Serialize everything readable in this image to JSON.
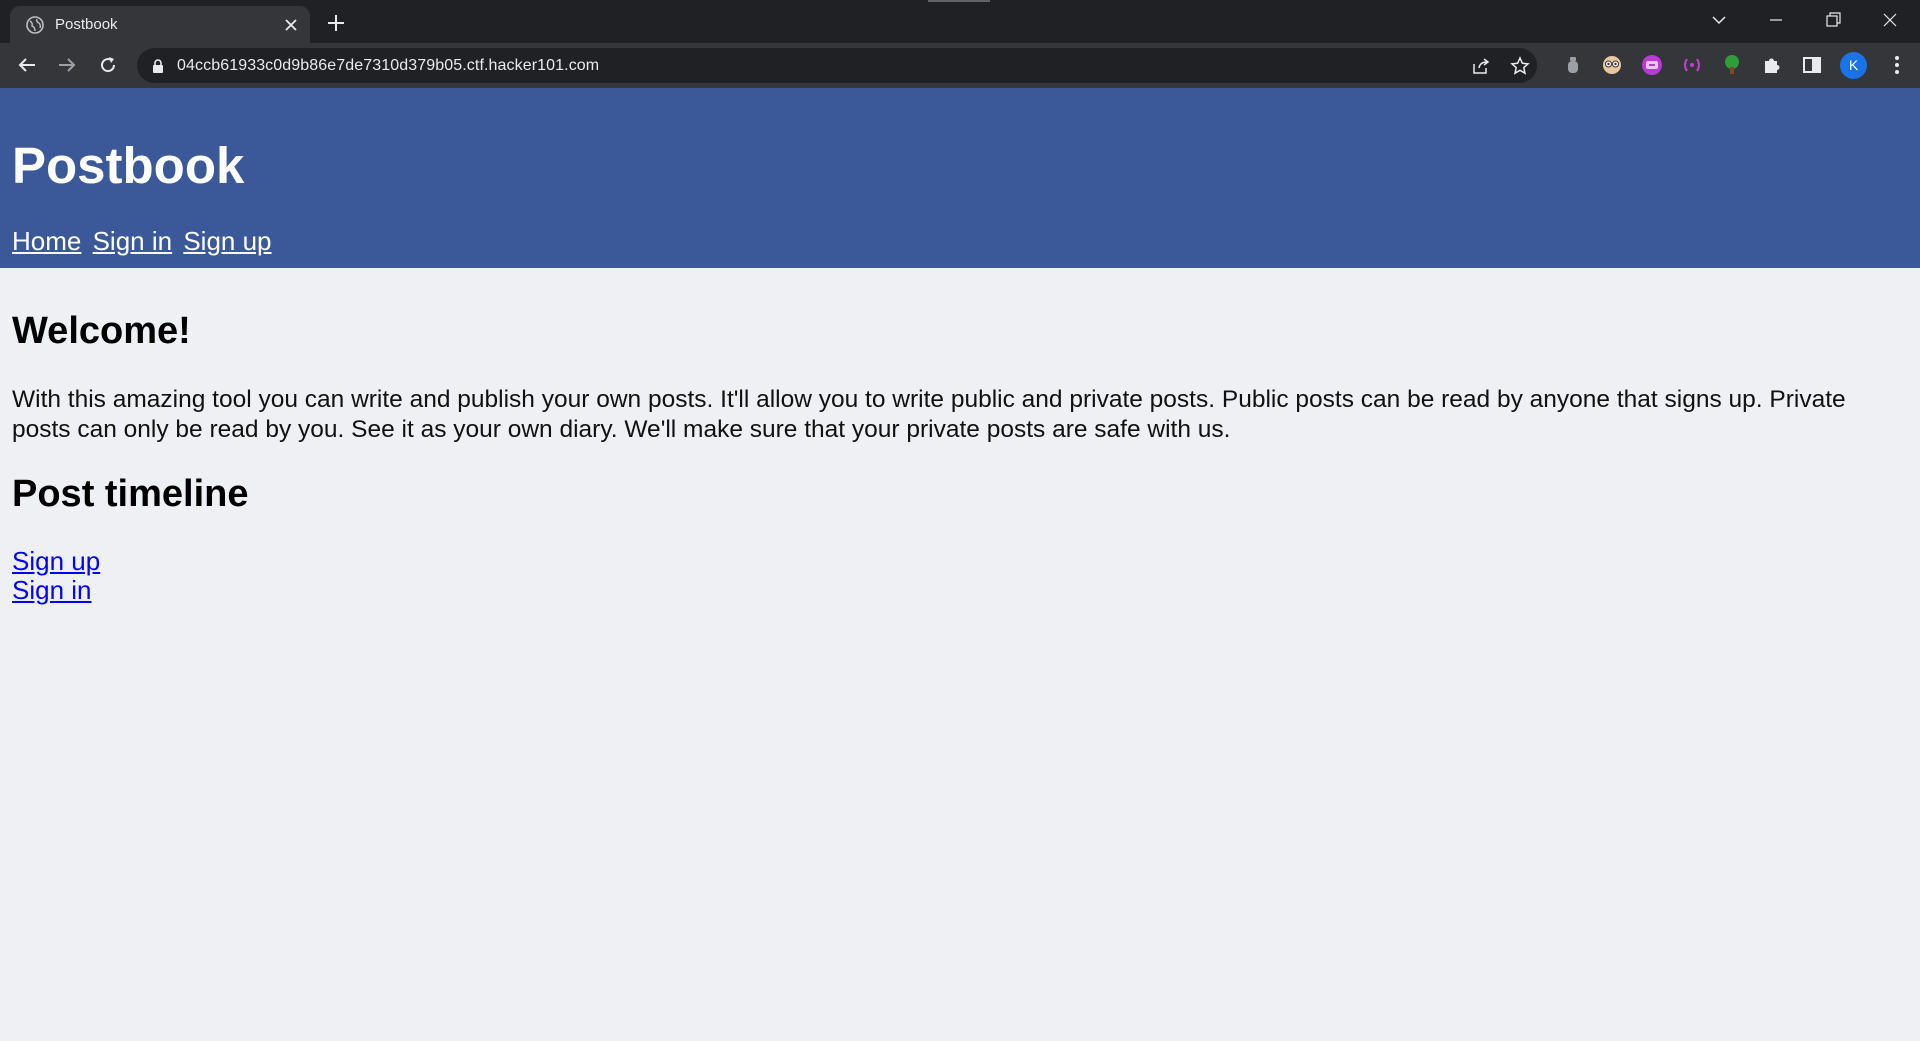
{
  "browser": {
    "tab_title": "Postbook",
    "url": "04ccb61933c0d9b86e7de7310d379b05.ctf.hacker101.com",
    "profile_initial": "K",
    "icons": [
      "globe-icon",
      "close-icon",
      "plus-icon",
      "back-icon",
      "forward-icon",
      "reload-icon",
      "lock-icon",
      "share-icon",
      "star-icon",
      "puzzle-icon",
      "sidepanel-icon",
      "menu-icon"
    ]
  },
  "site": {
    "title": "Postbook",
    "nav": {
      "home": "Home",
      "sign_in": "Sign in",
      "sign_up": "Sign up"
    },
    "colors": {
      "header_bg": "#3b5998",
      "page_bg": "#eef0f4",
      "link": "#0000ee"
    }
  },
  "main": {
    "welcome_heading": "Welcome!",
    "intro": "With this amazing tool you can write and publish your own posts. It'll allow you to write public and private posts. Public posts can be read by anyone that signs up. Private posts can only be read by you. See it as your own diary. We'll make sure that your private posts are safe with us.",
    "timeline_heading": "Post timeline",
    "timeline_links": {
      "sign_up": "Sign up",
      "sign_in": "Sign in"
    }
  }
}
